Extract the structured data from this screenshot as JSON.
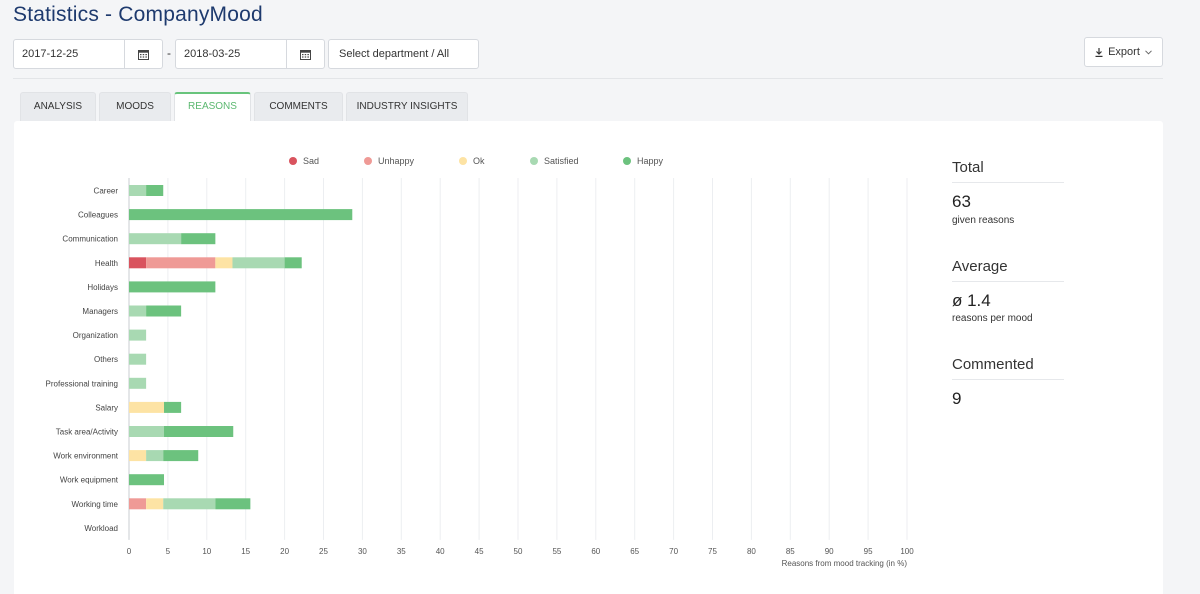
{
  "page": {
    "title": "Statistics - CompanyMood"
  },
  "filters": {
    "date_from": "2017-12-25",
    "date_to": "2018-03-25",
    "dash": "-",
    "department": "Select department / All",
    "export_label": "Export"
  },
  "tabs": [
    "ANALYSIS",
    "MOODS",
    "REASONS",
    "COMMENTS",
    "INDUSTRY INSIGHTS"
  ],
  "active_tab": "REASONS",
  "colors": {
    "sad": "#d9535e",
    "unhappy": "#ef9a96",
    "ok": "#fde3a4",
    "satisfied": "#a8d9b2",
    "happy": "#6cc27e",
    "title": "#1e3a6e"
  },
  "stats": {
    "total_heading": "Total",
    "total_value": "63",
    "total_sub": "given reasons",
    "avg_heading": "Average",
    "avg_value": "ø 1.4",
    "avg_sub": "reasons per mood",
    "commented_heading": "Commented",
    "commented_value": "9"
  },
  "chart_data": {
    "type": "bar",
    "orientation": "horizontal",
    "stacked": true,
    "categories": [
      "Career",
      "Colleagues",
      "Communication",
      "Health",
      "Holidays",
      "Managers",
      "Organization",
      "Others",
      "Professional training",
      "Salary",
      "Task area/Activity",
      "Work environment",
      "Work equipment",
      "Working time",
      "Workload"
    ],
    "series": [
      {
        "name": "Sad",
        "color": "#d9535e",
        "values": [
          0,
          0,
          0,
          2.2,
          0,
          0,
          0,
          0,
          0,
          0,
          0,
          0,
          0,
          0,
          0
        ]
      },
      {
        "name": "Unhappy",
        "color": "#ef9a96",
        "values": [
          0,
          0,
          0,
          8.9,
          0,
          0,
          0,
          0,
          0,
          0,
          0,
          0,
          0,
          2.2,
          0
        ]
      },
      {
        "name": "Ok",
        "color": "#fde3a4",
        "values": [
          0,
          0,
          0,
          2.2,
          0,
          0,
          0,
          0,
          0,
          4.5,
          0,
          2.2,
          0,
          2.2,
          0
        ]
      },
      {
        "name": "Satisfied",
        "color": "#a8d9b2",
        "values": [
          2.2,
          0,
          6.7,
          6.7,
          0,
          2.2,
          2.2,
          2.2,
          2.2,
          0,
          4.5,
          2.2,
          0,
          6.7,
          0
        ]
      },
      {
        "name": "Happy",
        "color": "#6cc27e",
        "values": [
          2.2,
          28.7,
          4.4,
          2.2,
          11.1,
          4.5,
          0,
          0,
          0,
          2.2,
          8.9,
          4.5,
          4.5,
          4.5,
          0
        ]
      }
    ],
    "xticks": [
      0,
      5,
      10,
      15,
      20,
      25,
      30,
      35,
      40,
      45,
      50,
      55,
      60,
      65,
      70,
      75,
      80,
      85,
      90,
      95,
      100
    ],
    "xlim": [
      0,
      100
    ],
    "xlabel": "Reasons from mood tracking (in %)",
    "grid": true,
    "legend": "top"
  }
}
